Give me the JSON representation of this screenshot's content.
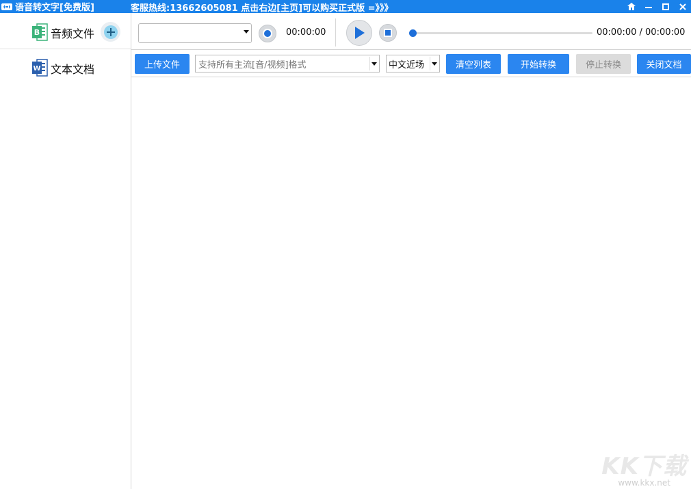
{
  "window": {
    "title": "语音转文字[免费版]",
    "hotline": "客服热线:13662605081  点击右边[主页]可以购买正式版 =》》》",
    "controls": [
      "home-icon",
      "minimize-icon",
      "maximize-icon",
      "close-icon"
    ]
  },
  "sidebar": {
    "items": [
      {
        "label": "音频文件",
        "icon": "excel-doc-icon"
      },
      {
        "label": "文本文档",
        "icon": "word-doc-icon"
      }
    ],
    "add_icon": "plus-icon"
  },
  "player": {
    "selected_audio": "",
    "record_time": "00:00:00",
    "play_time": "00:00:00 / 00:00:00",
    "progress": 0
  },
  "toolbar": {
    "upload_label": "上传文件",
    "format_placeholder": "支持所有主流[音/视频]格式",
    "language_value": "中文近场",
    "clear_label": "清空列表",
    "start_label": "开始转换",
    "stop_label": "停止转换",
    "close_label": "关闭文档"
  },
  "watermark": {
    "logo": "KK下载",
    "url": "www.kkx.net"
  },
  "colors": {
    "titlebar": "#1a82ea",
    "button": "#2b86f0",
    "disabled_button": "#dcdcdc"
  }
}
